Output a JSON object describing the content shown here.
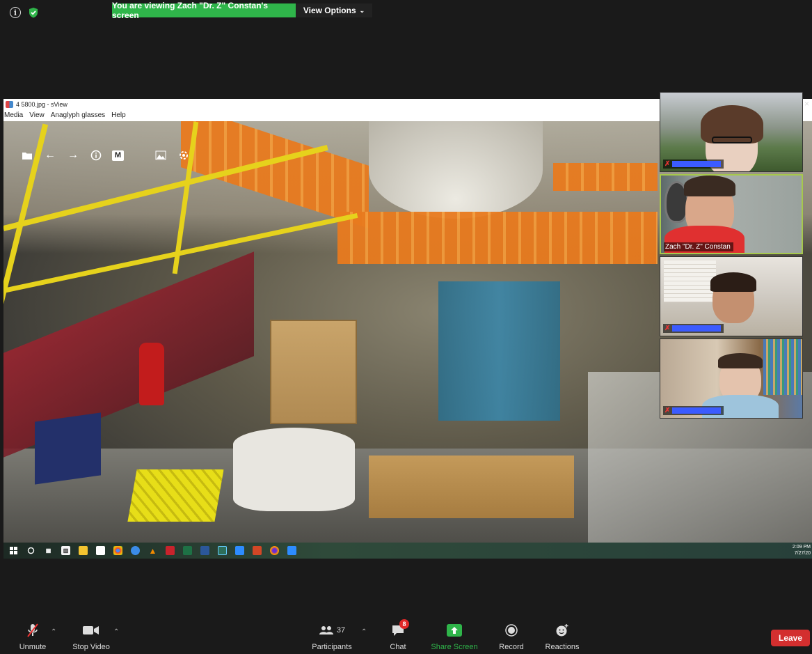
{
  "banner": {
    "viewing_text": "You are viewing Zach \"Dr. Z\" Constan's screen",
    "view_options": "View Options"
  },
  "icons": {
    "info": "info-icon",
    "security": "shield-icon"
  },
  "sview": {
    "title": "4 5800.jpg - sView",
    "menu": [
      "Media",
      "View",
      "Anaglyph glasses",
      "Help"
    ],
    "toolbar_m": "M"
  },
  "taskbar": {
    "time": "2:09 PM",
    "date": "7/27/20"
  },
  "gallery": [
    {
      "name": "",
      "redacted": true,
      "muted": true
    },
    {
      "name": "Zach \"Dr. Z\" Constan",
      "redacted": false,
      "muted": false,
      "active": true
    },
    {
      "name": "",
      "redacted": true,
      "muted": true
    },
    {
      "name": "",
      "redacted": true,
      "muted": true
    }
  ],
  "controls": {
    "unmute": "Unmute",
    "stop_video": "Stop Video",
    "participants": "Participants",
    "participants_count": "37",
    "chat": "Chat",
    "chat_badge": "8",
    "share_screen": "Share Screen",
    "record": "Record",
    "reactions": "Reactions",
    "leave": "Leave"
  },
  "colors": {
    "banner_green": "#2fb54a",
    "leave_red": "#d32f2f",
    "share_green": "#2fb54a",
    "active_border": "#a6c84c"
  }
}
